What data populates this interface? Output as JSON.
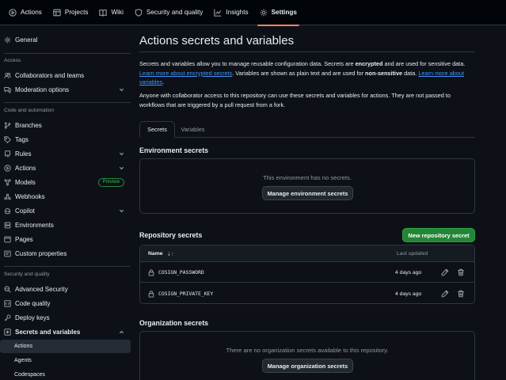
{
  "topnav": {
    "items": [
      {
        "label": "Actions",
        "icon": "play-icon"
      },
      {
        "label": "Projects",
        "icon": "table-icon"
      },
      {
        "label": "Wiki",
        "icon": "book-icon"
      },
      {
        "label": "Security and quality",
        "icon": "shield-icon"
      },
      {
        "label": "Insights",
        "icon": "graph-icon"
      },
      {
        "label": "Settings",
        "icon": "gear-icon",
        "active": true
      }
    ]
  },
  "sidebar": {
    "general": "General",
    "section_access": "Access",
    "collaborators": "Collaborators and teams",
    "moderation": "Moderation options",
    "section_code": "Code and automation",
    "branches": "Branches",
    "tags": "Tags",
    "rules": "Rules",
    "actions": "Actions",
    "models": "Models",
    "models_badge": "Preview",
    "webhooks": "Webhooks",
    "copilot": "Copilot",
    "environments": "Environments",
    "pages": "Pages",
    "custom_properties": "Custom properties",
    "section_security": "Security and quality",
    "advanced_security": "Advanced Security",
    "code_quality": "Code quality",
    "deploy_keys": "Deploy keys",
    "secrets_variables": "Secrets and variables",
    "sub_actions": "Actions",
    "sub_agents": "Agents",
    "sub_codespaces": "Codespaces"
  },
  "main": {
    "title": "Actions secrets and variables",
    "intro_1": "Secrets and variables allow you to manage reusable configuration data. Secrets are ",
    "intro_encrypted": "encrypted",
    "intro_2": " and are used for sensitive data. ",
    "link_encrypted": "Learn more about encrypted secrets",
    "intro_3": ". Variables are shown as plain text and are used for ",
    "intro_nonsensitive": "non-sensitive",
    "intro_4": " data. ",
    "link_variables": "Learn more about variables",
    "intro_5": ".",
    "collab_note": "Anyone with collaborator access to this repository can use these secrets and variables for actions. They are not passed to workflows that are triggered by a pull request from a fork.",
    "tabs": [
      {
        "label": "Secrets"
      },
      {
        "label": "Variables"
      }
    ],
    "env_heading": "Environment secrets",
    "env_empty": "This environment has no secrets.",
    "env_button": "Manage environment secrets",
    "repo_heading": "Repository secrets",
    "new_secret_button": "New repository secret",
    "col_name": "Name",
    "sort_glyph": "⇣↑",
    "col_updated": "Last updated",
    "secrets": [
      {
        "name": "COSIGN_PASSWORD",
        "updated": "4 days ago"
      },
      {
        "name": "COSIGN_PRIVATE_KEY",
        "updated": "4 days ago"
      }
    ],
    "org_heading": "Organization secrets",
    "org_empty": "There are no organization secrets available to this repository.",
    "org_button": "Manage organization secrets"
  }
}
